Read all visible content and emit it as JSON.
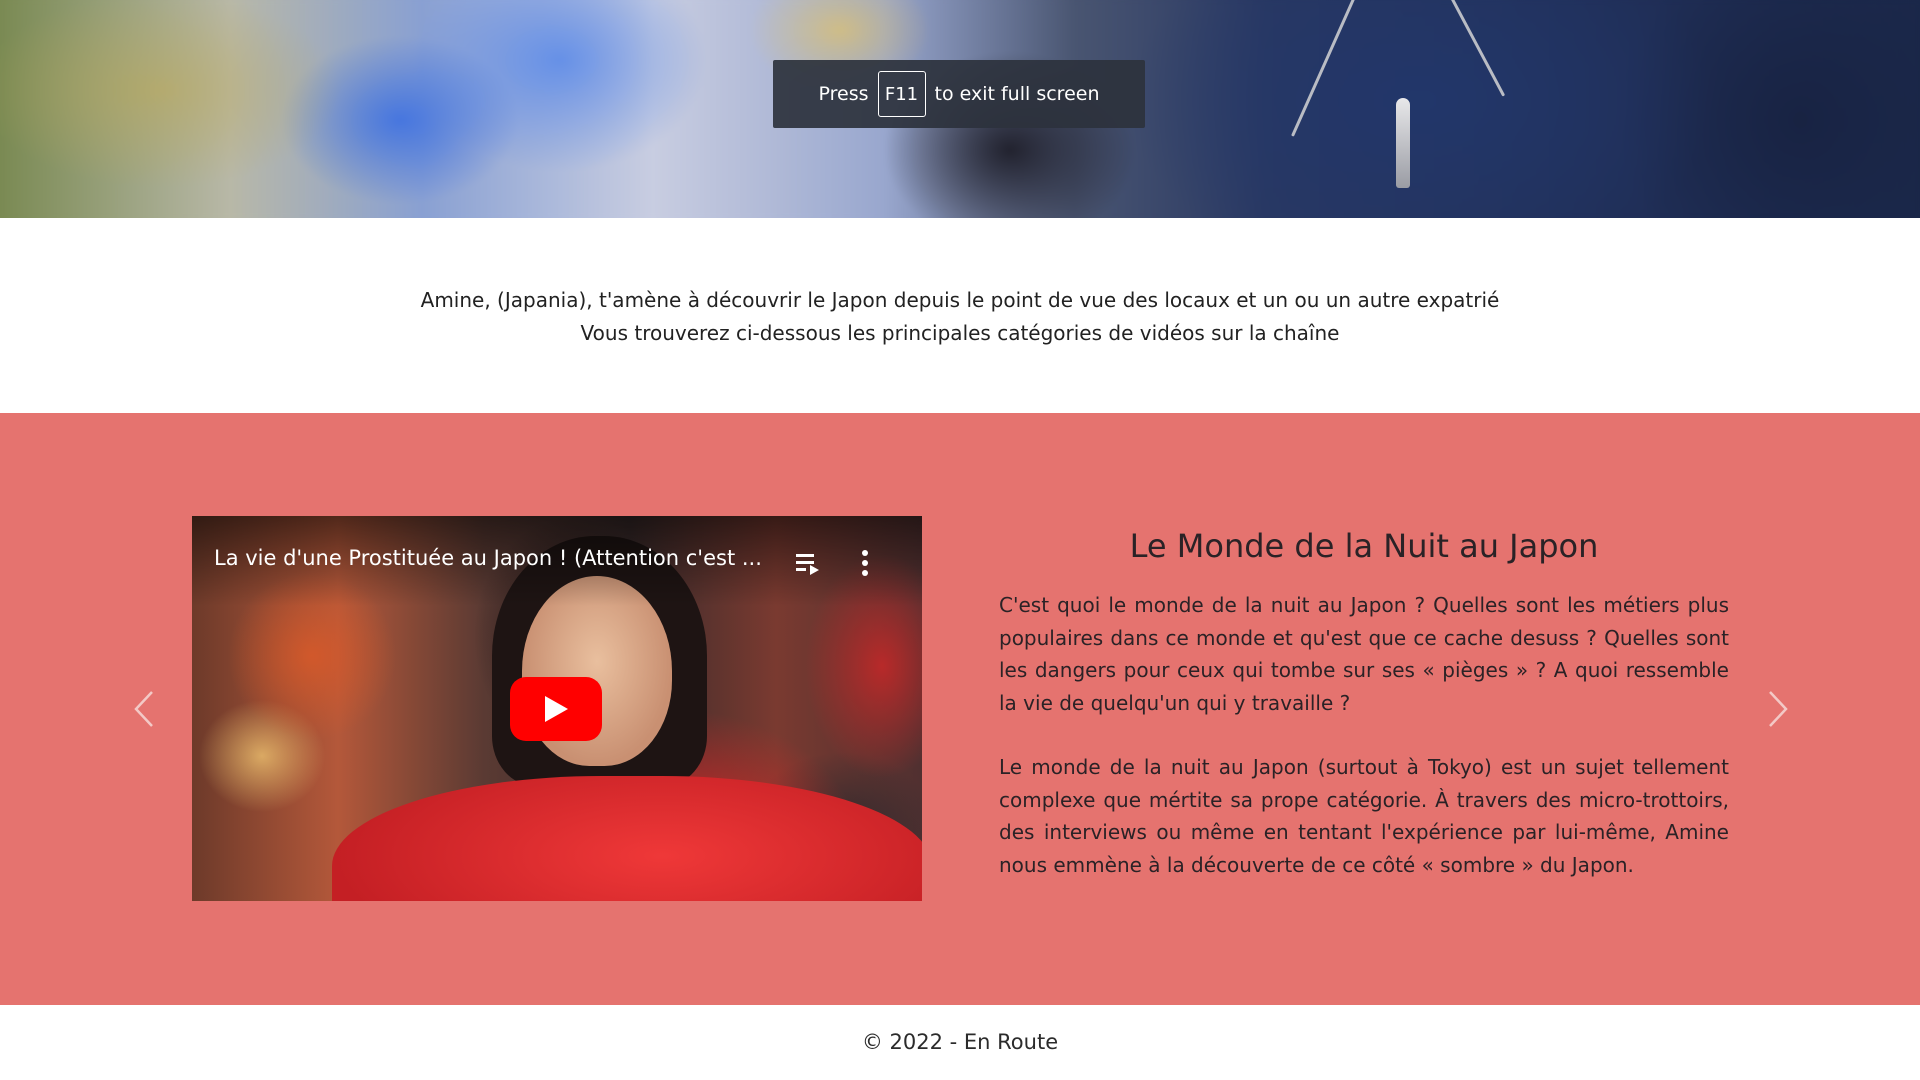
{
  "fullscreen_toast": {
    "press": "Press",
    "key": "F11",
    "message": "to exit full screen"
  },
  "intro": {
    "line1": "Amine, (Japania), t'amène à découvrir le Japon depuis le point de vue des locaux et un ou un autre expatrié",
    "line2": "Vous trouverez ci-dessous les principales catégories de vidéos sur la chaîne"
  },
  "feature": {
    "background_color": "#e5736f",
    "video": {
      "title": "La vie d'une Prostituée au Japon ! (Attention c'est ...",
      "play_button_color": "#ff0000"
    },
    "title": "Le Monde de la Nuit au Japon",
    "paragraph1": "C'est quoi le monde de la nuit au Japon ? Quelles sont les métiers plus populaires dans ce monde et qu'est que ce cache desuss ? Quelles sont les dangers pour ceux qui tombe sur ses « pièges » ? A quoi ressemble la vie de quelqu'un qui y travaille ?",
    "paragraph2": "Le monde de la nuit au Japon (surtout à Tokyo) est un sujet tellement complexe que mértite sa prope catégorie. À travers des micro-trottoirs, des interviews ou même en tentant l'expérience par lui-même, Amine nous emmène à la découverte de ce côté « sombre » du Japon.",
    "prev_icon": "chevron-left-icon",
    "next_icon": "chevron-right-icon"
  },
  "footer": {
    "copyright": "© 2022 - En Route"
  }
}
